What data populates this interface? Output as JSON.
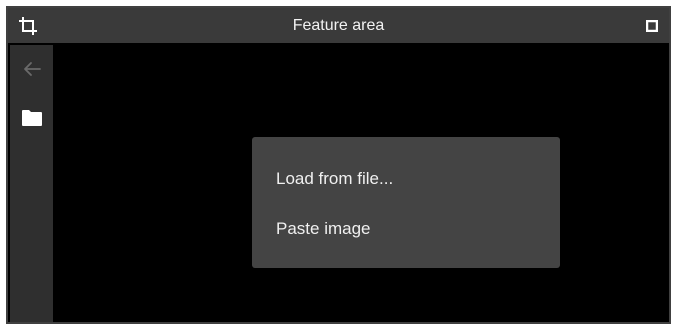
{
  "window": {
    "title": "Feature area",
    "title_icon": "crop-icon",
    "maximize_icon": "maximize-icon"
  },
  "sidebar": {
    "items": [
      {
        "icon": "back-arrow-icon",
        "enabled": false
      },
      {
        "icon": "folder-icon",
        "enabled": true
      }
    ]
  },
  "context_menu": {
    "items": [
      {
        "label": "Load from file..."
      },
      {
        "label": "Paste image"
      }
    ]
  },
  "colors": {
    "titlebar_bg": "#3a3a3a",
    "sidebar_bg": "#2f2f2f",
    "canvas_bg": "#000000",
    "menu_bg": "#444444",
    "text": "#f0f0f0",
    "disabled_icon": "#6a6a6a"
  }
}
